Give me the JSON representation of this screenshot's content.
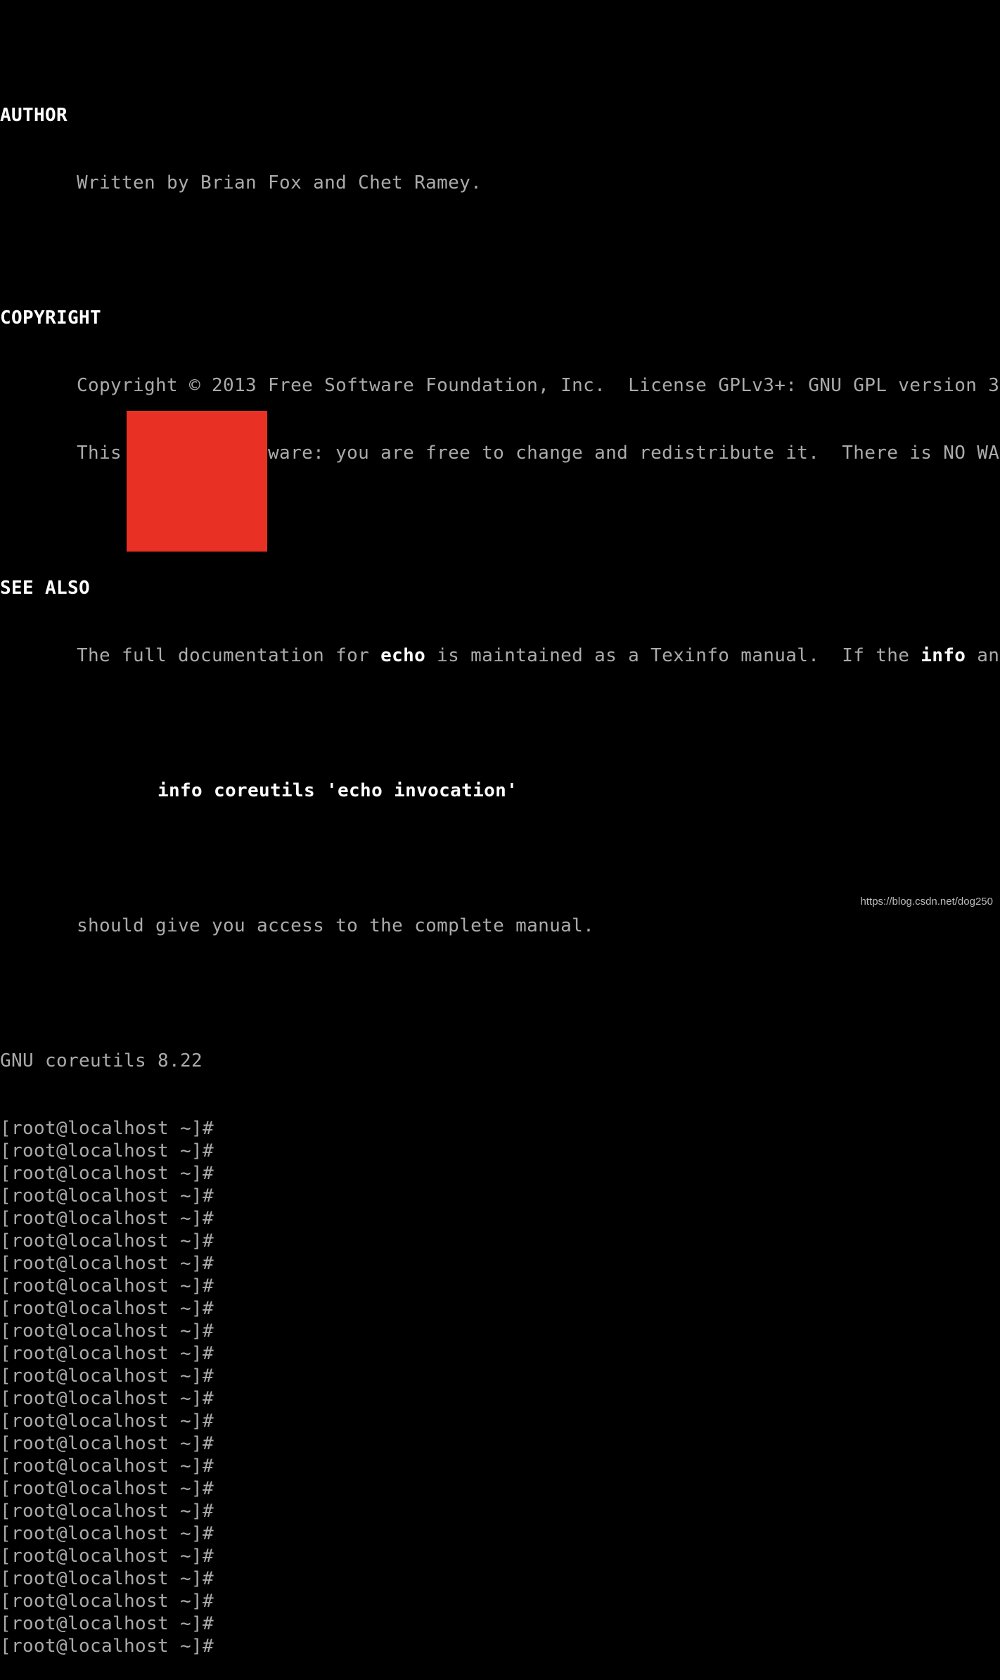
{
  "terminal": {
    "top_partial_line": "       ...",
    "author_heading": "AUTHOR",
    "author_text": "Written by Brian Fox and Chet Ramey.",
    "copyright_heading": "COPYRIGHT",
    "copyright_line1": "Copyright © 2013 Free Software Foundation, Inc.  License GPLv3+: GNU GPL version 3",
    "copyright_line2": "This is free software: you are free to change and redistribute it.  There is NO WA",
    "see_also_heading": "SEE ALSO",
    "see_also_pre": "The full documentation for ",
    "see_also_echo": "echo",
    "see_also_mid": " is maintained as a Texinfo manual.  If the ",
    "see_also_info": "info",
    "see_also_post": " an",
    "info_command": "info coreutils 'echo invocation'",
    "manual_text": "should give you access to the complete manual.",
    "footer": "GNU coreutils 8.22",
    "prompts": [
      "[root@localhost ~]#",
      "[root@localhost ~]#",
      "[root@localhost ~]#",
      "[root@localhost ~]#",
      "[root@localhost ~]#",
      "[root@localhost ~]#",
      "[root@localhost ~]#",
      "[root@localhost ~]#",
      "[root@localhost ~]#",
      "[root@localhost ~]#",
      "[root@localhost ~]#",
      "[root@localhost ~]#",
      "[root@localhost ~]#",
      "[root@localhost ~]#",
      "[root@localhost ~]#",
      "[root@localhost ~]#",
      "[root@localhost ~]#",
      "[root@localhost ~]#",
      "[root@localhost ~]#",
      "[root@localhost ~]#",
      "[root@localhost ~]#",
      "[root@localhost ~]#",
      "[root@localhost ~]#",
      "[root@localhost ~]#"
    ]
  },
  "watermark": "https://blog.csdn.net/dog250",
  "colors": {
    "background": "#000000",
    "text": "#aaaaaa",
    "bold": "#ffffff",
    "redaction": "#e83124"
  }
}
